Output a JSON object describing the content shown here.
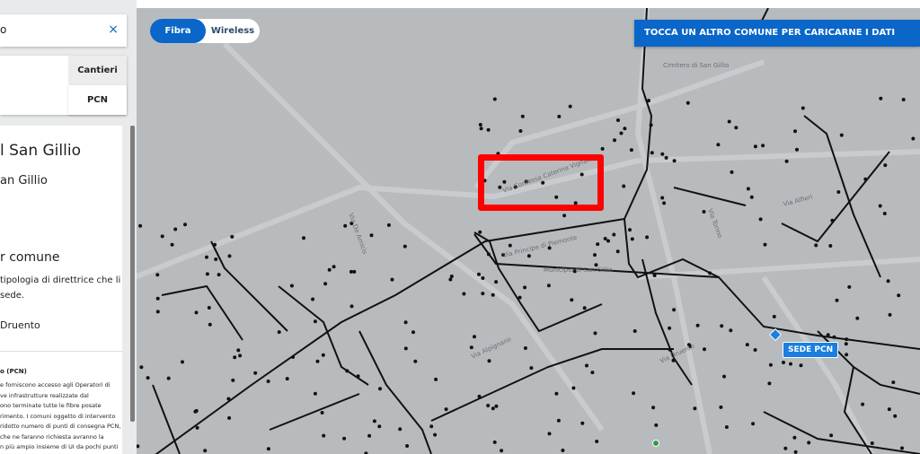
{
  "search": {
    "value": "o",
    "clear_icon": "×"
  },
  "tabs": [
    {
      "label": "Cantieri"
    },
    {
      "label": "PCN"
    }
  ],
  "info": {
    "title": "l San Gillio",
    "subtitle": "an Gillio",
    "section_title": "r comune",
    "line1": "tipologia di direttrice che li",
    "line2": " sede.",
    "line3": " Druento",
    "pcn_title": "o (PCN)",
    "pcn_lines": [
      "e forniscono accesso agli Operatori di",
      "ve infrastrutture realizzate dal",
      "ono terminate tutte le fibre posate",
      "rimento. I comuni oggetto di intervento",
      "ridotto numero di punti di consegna PCN,",
      "che ne faranno richiesta avranno la",
      "n più ampio insieme di UI da pochi punti"
    ]
  },
  "toggle": {
    "fibra": "Fibra",
    "wireless": "Wireless",
    "active": "Fibra"
  },
  "banner": "TOCCA UN ALTRO COMUNE PER CARICARNE I DATI",
  "marker": {
    "label": "SEDE PCN"
  },
  "map_labels": [
    "Via Contessa Caterina Vignati",
    "Via Principe di Piemonte",
    "Municipio di San Gillio",
    "Cimitero di San Gillio",
    "Via Alfieri",
    "Via Alpignano",
    "Via De Amicis",
    "Via Torino",
    "Via Druento"
  ],
  "colors": {
    "accent": "#0a66c8",
    "highlight": "#ff0000",
    "map_bg": "#b8bbbe"
  }
}
